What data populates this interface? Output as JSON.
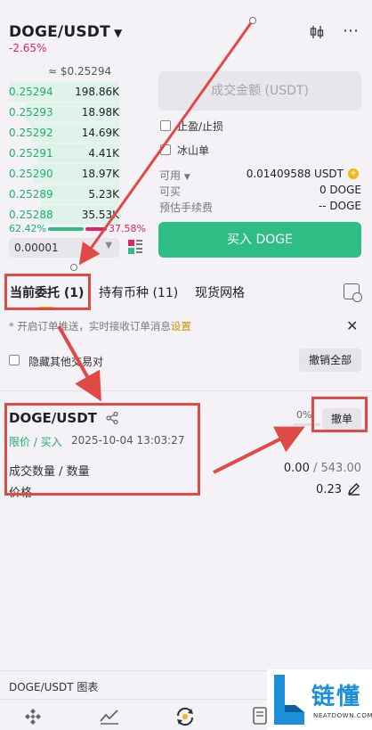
{
  "header": {
    "pair": "DOGE/USDT",
    "change": "-2.65%",
    "icons": [
      "candlestick-icon",
      "more-icon"
    ]
  },
  "order_book": {
    "mid_price": "≈ $0.25294",
    "bids": [
      {
        "price": "0.25294",
        "qty": "198.86K",
        "depth": 1.0
      },
      {
        "price": "0.25293",
        "qty": "18.98K",
        "depth": 0.85
      },
      {
        "price": "0.25292",
        "qty": "14.69K",
        "depth": 0.8
      },
      {
        "price": "0.25291",
        "qty": "4.41K",
        "depth": 0.75
      },
      {
        "price": "0.25290",
        "qty": "18.97K",
        "depth": 0.78
      },
      {
        "price": "0.25289",
        "qty": "5.23K",
        "depth": 0.7
      },
      {
        "price": "0.25288",
        "qty": "35.53K",
        "depth": 0.72
      }
    ],
    "buy_ratio": "62.42%",
    "sell_ratio": "37.58%",
    "precision": "0.00001"
  },
  "order_form": {
    "amount_placeholder": "成交金额 (USDT)",
    "tp_sl_label": "止盈/止损",
    "iceberg_label": "冰山单",
    "available_label": "可用",
    "available_value": "0.01409588 USDT",
    "buyable_label": "可买",
    "buyable_value": "0 DOGE",
    "fee_label": "预估手续费",
    "fee_value": "-- DOGE",
    "buy_button": "买入 DOGE"
  },
  "tabs": {
    "open_orders": "当前委托 (1)",
    "holdings": "持有币种 (11)",
    "grid": "现货网格"
  },
  "notice": {
    "text": "* 开启订单推送，实时接收订单消息",
    "link": "设置"
  },
  "filter": {
    "hide_other_pairs": "隐藏其他交易对",
    "cancel_all": "撤销全部"
  },
  "order": {
    "pair": "DOGE/USDT",
    "type": "限价 / 买入",
    "time": "2025-10-04 13:03:27",
    "fill_percent": "0%",
    "cancel": "撤单",
    "filled_label": "成交数量 / 数量",
    "filled_value": "0.00",
    "total_value": "543.00",
    "price_label": "价格",
    "price_value": "0.23"
  },
  "footer": {
    "chart_link": "DOGE/USDT 图表",
    "nav_icons": [
      "home-icon",
      "markets-icon",
      "trade-icon",
      "assets-icon"
    ]
  },
  "watermark": {
    "text": "链懂",
    "sub": "NEATDOWN.COM"
  },
  "colors": {
    "green": "#2ebd85",
    "red": "#e0245e",
    "accent": "#f0b90b",
    "annotation": "#e04a45"
  }
}
